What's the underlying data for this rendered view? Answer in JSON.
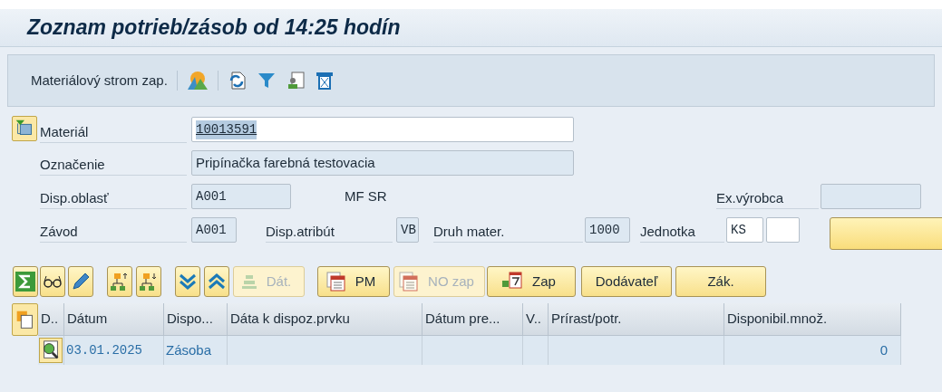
{
  "title": "Zoznam potrieb/zásob od 14:25 hodín",
  "toolbar": {
    "button": "Materiálový strom zap."
  },
  "form": {
    "material": {
      "label": "Materiál",
      "value": "10013591",
      "selected": true
    },
    "designation": {
      "label": "Označenie",
      "value": "Pripínačka farebná testovacia"
    },
    "mrp_area": {
      "label": "Disp.oblasť",
      "value": "A001",
      "text": "MF SR"
    },
    "manufacturer": {
      "label": "Ex.výrobca"
    },
    "plant": {
      "label": "Závod",
      "value": "A001"
    },
    "mrp_type": {
      "label": "Disp.atribút",
      "value": "VB"
    },
    "material_type": {
      "label": "Druh mater.",
      "value": "1000"
    },
    "unit": {
      "label": "Jednotka",
      "value": "KS"
    }
  },
  "buttons": [
    {
      "kind": "sigma",
      "disabled": false
    },
    {
      "kind": "glasses",
      "disabled": false
    },
    {
      "kind": "pencil",
      "disabled": false
    },
    {
      "kind": "hier-up",
      "disabled": false
    },
    {
      "kind": "hier-down",
      "disabled": false
    },
    {
      "kind": "expand",
      "disabled": false
    },
    {
      "kind": "collapse",
      "disabled": false
    },
    {
      "kind": "stack",
      "label": "Dát.",
      "disabled": true
    },
    {
      "kind": "calendar",
      "label": "PM",
      "disabled": false
    },
    {
      "kind": "calendar",
      "label": "NO zap",
      "disabled": true
    },
    {
      "kind": "calendar7",
      "label": "Zap",
      "disabled": false
    },
    {
      "kind": "text",
      "label": "Dodávateľ",
      "disabled": false
    },
    {
      "kind": "text",
      "label": "Zák.",
      "disabled": false
    }
  ],
  "table": {
    "columns": [
      "D..",
      "Dátum",
      "Dispo...",
      "Dáta k dispoz.prvku",
      "Dátum pre...",
      "V..",
      "Prírast/potr.",
      "Disponibil.množ."
    ],
    "rows": [
      {
        "date": "03.01.2025",
        "element": "Zásoba",
        "available": "0"
      }
    ]
  }
}
